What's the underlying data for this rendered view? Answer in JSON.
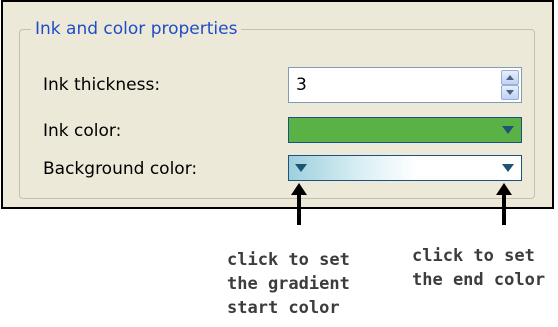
{
  "group": {
    "title": "Ink and color properties"
  },
  "fields": {
    "thickness_label": "Ink thickness:",
    "thickness_value": "3",
    "ink_color_label": "Ink color:",
    "background_color_label": "Background color:"
  },
  "colors": {
    "ink_color": "#5ab146",
    "gradient_start": "#9ed0dc",
    "gradient_end": "#ffffff"
  },
  "icons": {
    "spin_up": "spin-up-icon",
    "spin_down": "spin-down-icon",
    "dropdown": "dropdown-arrow-icon",
    "callout": "callout-arrow-icon"
  },
  "annotations": {
    "start_line1": "click to set",
    "start_line2": "the gradient",
    "start_line3": "start color",
    "end_line1": "click to set",
    "end_line2": "the end color"
  }
}
